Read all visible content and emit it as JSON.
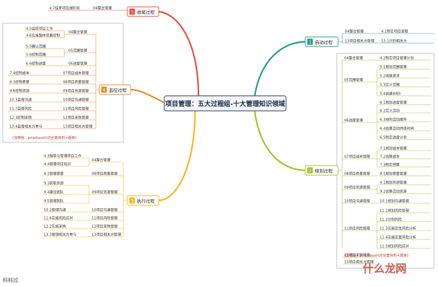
{
  "center_title": "项目管理：五大过程组-十大管理知识领域",
  "footer": "科科过",
  "watermark": "什么龙网",
  "branches": {
    "closing": {
      "number": "5",
      "label": "收尾过程",
      "color": "#e84d3c",
      "area": "04整合管理",
      "process": "4.7结束项目或阶段"
    },
    "initiating": {
      "number": "1",
      "label": "启动过程",
      "color": "#1f9e8c",
      "rows": [
        {
          "area": "04整合管理",
          "process": "4.1制定项目章程"
        },
        {
          "area": "13项目相关方管理",
          "process": "13.1识别相关方"
        }
      ]
    },
    "monitoring": {
      "number": "4",
      "label": "监控过程",
      "color": "#ef8a26",
      "groups": [
        {
          "area": "04整合管理",
          "processes": [
            "4.5监控项目工作",
            "4.6实施整体变更控制"
          ]
        },
        {
          "area": "05范围管理",
          "processes": [
            "5.5确认范围",
            "5.6控制范围"
          ]
        },
        {
          "area": "06进度管理",
          "processes": [
            "6.6控制进度"
          ]
        }
      ],
      "rows": [
        {
          "process": "7.4控制成本",
          "area": "07项目成本管理"
        },
        {
          "process": "8.3控制质量",
          "area": "08项目质量管理"
        },
        {
          "process": "9.6控制资源",
          "area": "09项目资源管理"
        },
        {
          "process": "10.3监督沟通",
          "area": "10项目沟通管理"
        },
        {
          "process": "11.7监督风险",
          "area": "11项目风险管理"
        },
        {
          "process": "12.3控制采购",
          "area": "12项目采购管理"
        },
        {
          "process": "13.4监督相关方参与",
          "area": "13项目相关方管理"
        }
      ],
      "note": "(加微信：pmpkaoshi还全套资料+题库)"
    },
    "executing": {
      "number": "3",
      "label": "执行过程",
      "color": "#f2b817",
      "groups": [
        {
          "area": "04整合管理",
          "processes": [
            "4.3指导与管理项目工作",
            "4.4管理项目知识"
          ]
        },
        {
          "area": "08项目质量管理",
          "processes": [
            "8.2管理质量"
          ]
        },
        {
          "area": "09项目资源管理",
          "processes": [
            "9.3获取资源",
            "9.4建设团队",
            "9.5管理团队"
          ]
        },
        {
          "area": "10项目沟通管理",
          "processes": [
            "10.2管理沟通"
          ]
        },
        {
          "area": "11项目风险管理",
          "processes": [
            "11.6实施风险应对"
          ]
        },
        {
          "area": "12项目采购管理",
          "processes": [
            "12.2实施采购"
          ]
        },
        {
          "area": "13项目相关方管理",
          "processes": [
            "13.3管理相关方参与"
          ]
        }
      ]
    },
    "planning": {
      "number": "2",
      "label": "规划过程",
      "color": "#a8bf2a",
      "groups": [
        {
          "area": "04整合管理",
          "processes": [
            "4.2制定项目管理计划"
          ]
        },
        {
          "area": "05范围管理",
          "processes": [
            "5.1规划范围管理",
            "5.2收集需求",
            "5.3定义范围",
            "5.4创建WBS"
          ]
        },
        {
          "area": "06进度管理",
          "processes": [
            "6.1规划进度管理",
            "6.2定义活动",
            "6.3排列活动顺序",
            "6.4估算活动持续时间",
            "6.5制定进度计划"
          ]
        },
        {
          "area": "07项目成本管理",
          "processes": [
            "7.1规划成本管理",
            "7.2估算成本",
            "7.3制定预算"
          ]
        },
        {
          "area": "08项目质量管理",
          "processes": [
            "8.1规划质量管理"
          ]
        },
        {
          "area": "09项目资源管理",
          "processes": [
            "9.1规划资源管理",
            "9.2估算活动资源"
          ]
        },
        {
          "area": "10项目沟通管理",
          "processes": [
            "10.1规划沟通管理"
          ]
        },
        {
          "area": "11项目风险管理",
          "processes": [
            "11.1规划风险管理",
            "11.2识别风险",
            "11.3实施定性风险分析",
            "11.4实施定量风险分析",
            "11.5规划风险应对"
          ]
        },
        {
          "area": "12项目采购管理",
          "processes": [
            "12.1规划采购管理"
          ]
        },
        {
          "area": "13项目相关方管理",
          "processes": [
            "13.2规划相关方参与"
          ]
        }
      ],
      "note": "(加微信：pmpkaoshi还全套资料+题库)"
    }
  }
}
